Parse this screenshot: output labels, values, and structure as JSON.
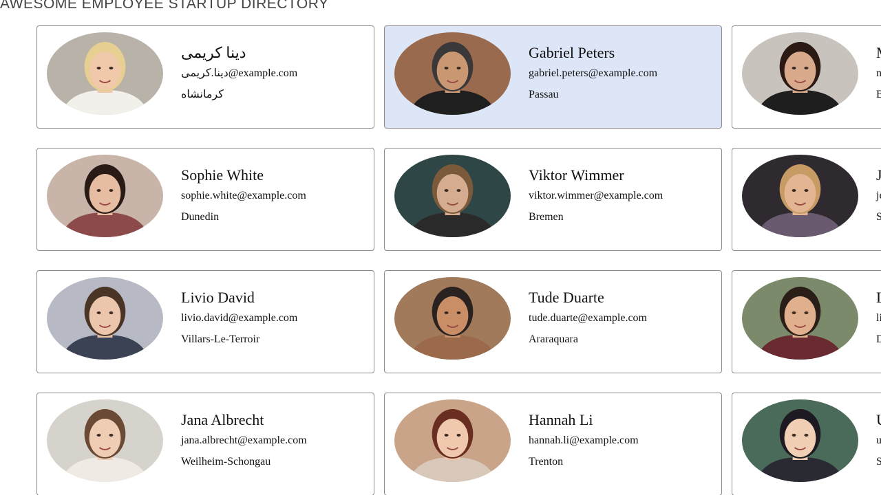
{
  "header": {
    "title": "AWESOME EMPLOYEE STARTUP DIRECTORY"
  },
  "employees": [
    {
      "name": "دينا كريمی",
      "email": "دينا.كريمی@example.com",
      "city": "كرمانشاه",
      "selected": false,
      "colors": {
        "bg": "#b8b2a8",
        "skin": "#f0c9aa",
        "hair": "#e6cf90",
        "shirt": "#f2f0ea"
      }
    },
    {
      "name": "Gabriel Peters",
      "email": "gabriel.peters@example.com",
      "city": "Passau",
      "selected": true,
      "colors": {
        "bg": "#9a6a4e",
        "skin": "#c99772",
        "hair": "#3a3838",
        "shirt": "#1f1f1f"
      }
    },
    {
      "name": "M",
      "email": "m",
      "city": "B",
      "selected": false,
      "colors": {
        "bg": "#c9c3bd",
        "skin": "#d9a98c",
        "hair": "#2b1a14",
        "shirt": "#1e1e1e"
      }
    },
    {
      "name": "Sophie White",
      "email": "sophie.white@example.com",
      "city": "Dunedin",
      "selected": false,
      "colors": {
        "bg": "#c8b4a8",
        "skin": "#e6bca2",
        "hair": "#2a1a16",
        "shirt": "#8c4a4a"
      }
    },
    {
      "name": "Viktor Wimmer",
      "email": "viktor.wimmer@example.com",
      "city": "Bremen",
      "selected": false,
      "colors": {
        "bg": "#2f4646",
        "skin": "#d6ac90",
        "hair": "#7a5a3a",
        "shirt": "#2a2a2a"
      }
    },
    {
      "name": "J",
      "email": "je",
      "city": "S",
      "selected": false,
      "colors": {
        "bg": "#2e2a30",
        "skin": "#e3b592",
        "hair": "#c89a64",
        "shirt": "#6a5a70"
      }
    },
    {
      "name": "Livio David",
      "email": "livio.david@example.com",
      "city": "Villars-Le-Terroir",
      "selected": false,
      "colors": {
        "bg": "#b7b9c4",
        "skin": "#ebc6ac",
        "hair": "#4a3426",
        "shirt": "#3a4254"
      }
    },
    {
      "name": "Tude Duarte",
      "email": "tude.duarte@example.com",
      "city": "Araraquara",
      "selected": false,
      "colors": {
        "bg": "#a07a5a",
        "skin": "#c98e66",
        "hair": "#2a2220",
        "shirt": "#9a6a4a"
      }
    },
    {
      "name": "L",
      "email": "li",
      "city": "D",
      "selected": false,
      "colors": {
        "bg": "#7a8a6a",
        "skin": "#e0b08e",
        "hair": "#2a1e18",
        "shirt": "#6a2a32"
      }
    },
    {
      "name": "Jana Albrecht",
      "email": "jana.albrecht@example.com",
      "city": "Weilheim-Schongau",
      "selected": false,
      "colors": {
        "bg": "#d6d2cc",
        "skin": "#efcdb4",
        "hair": "#6a4a34",
        "shirt": "#efeae4"
      }
    },
    {
      "name": "Hannah Li",
      "email": "hannah.li@example.com",
      "city": "Trenton",
      "selected": false,
      "colors": {
        "bg": "#c9a488",
        "skin": "#f0c8ae",
        "hair": "#6a2e20",
        "shirt": "#d8c8ba"
      }
    },
    {
      "name": "U",
      "email": "u",
      "city": "S",
      "selected": false,
      "colors": {
        "bg": "#4a6a5a",
        "skin": "#f0cfb4",
        "hair": "#1e1a22",
        "shirt": "#2a2a32"
      }
    }
  ]
}
